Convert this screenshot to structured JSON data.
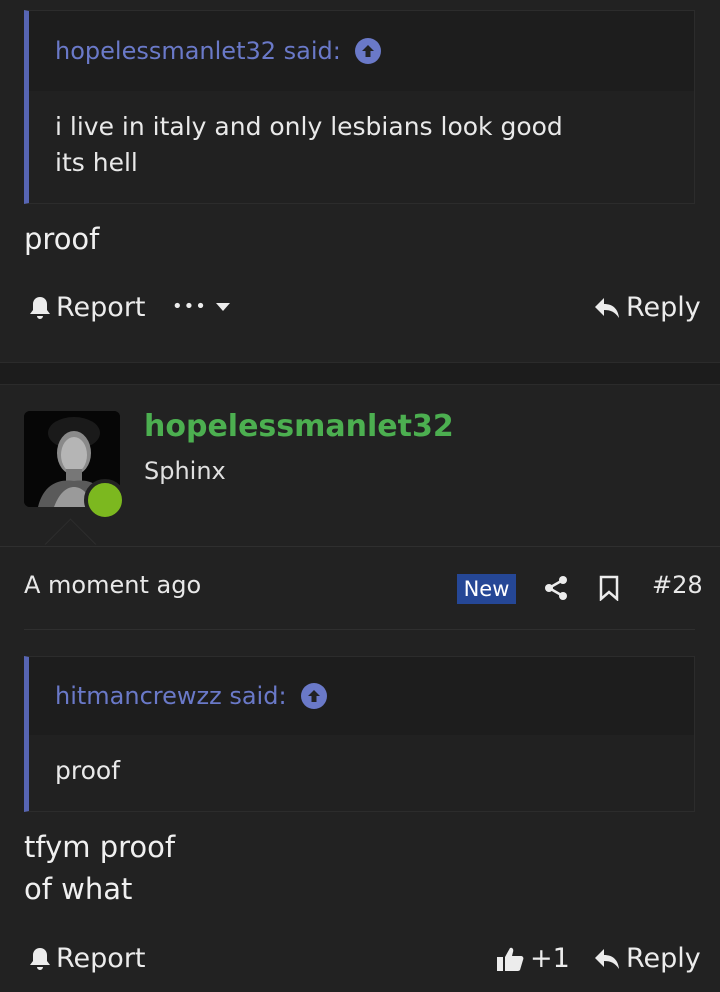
{
  "post1": {
    "quote": {
      "author_said": "hopelessmanlet32 said:",
      "lines": [
        "i live in italy and only lesbians look good",
        "its hell"
      ]
    },
    "message": [
      "proof"
    ],
    "actions": {
      "report": "Report",
      "more": "•••",
      "reply": "Reply"
    }
  },
  "post2": {
    "user": {
      "name": "hopelessmanlet32",
      "title": "Sphinx",
      "online_color": "#7cb81f"
    },
    "meta": {
      "timestamp": "A moment ago",
      "badge": "New",
      "number": "#28"
    },
    "quote": {
      "author_said": "hitmancrewzz said:",
      "lines": [
        "proof"
      ]
    },
    "message": [
      "tfym proof",
      "of what"
    ],
    "actions": {
      "report": "Report",
      "like_count": "+1",
      "reply": "Reply"
    }
  },
  "colors": {
    "accent": "#5765b3",
    "username": "#4caf50",
    "badge": "#254796"
  }
}
